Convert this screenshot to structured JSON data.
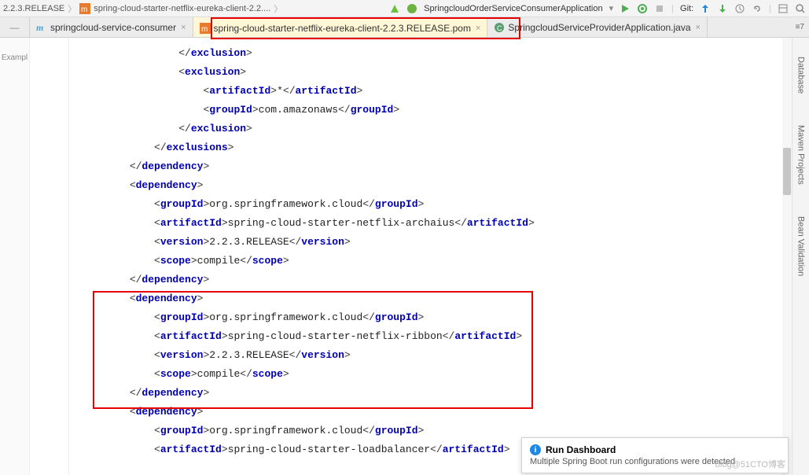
{
  "breadcrumb": {
    "item1": "2.2.3.RELEASE",
    "item2": "spring-cloud-starter-netflix-eureka-client-2.2...."
  },
  "runConfig": {
    "name": "SpringcloudOrderServiceConsumerApplication"
  },
  "git": {
    "label": "Git:"
  },
  "leftGutter": {
    "label": "Exampl"
  },
  "tabs": {
    "t1": "springcloud-service-consumer",
    "t2": "spring-cloud-starter-netflix-eureka-client-2.2.3.RELEASE.pom",
    "t3": "SpringcloudServiceProviderApplication.java"
  },
  "tabsRight": {
    "indicator": "≡7"
  },
  "code": {
    "l1_a": "</",
    "l1_b": "exclusion",
    "l1_c": ">",
    "l2_a": "<",
    "l2_b": "exclusion",
    "l2_c": ">",
    "l3_a": "<",
    "l3_b": "artifactId",
    "l3_c": ">",
    "l3_d": "*",
    "l3_e": "</",
    "l3_f": "artifactId",
    "l3_g": ">",
    "l4_a": "<",
    "l4_b": "groupId",
    "l4_c": ">",
    "l4_d": "com.amazonaws",
    "l4_e": "</",
    "l4_f": "groupId",
    "l4_g": ">",
    "l5_a": "</",
    "l5_b": "exclusion",
    "l5_c": ">",
    "l6_a": "</",
    "l6_b": "exclusions",
    "l6_c": ">",
    "l7_a": "</",
    "l7_b": "dependency",
    "l7_c": ">",
    "l8_a": "<",
    "l8_b": "dependency",
    "l8_c": ">",
    "l9_a": "<",
    "l9_b": "groupId",
    "l9_c": ">",
    "l9_d": "org.springframework.cloud",
    "l9_e": "</",
    "l9_f": "groupId",
    "l9_g": ">",
    "l10_a": "<",
    "l10_b": "artifactId",
    "l10_c": ">",
    "l10_d": "spring-cloud-starter-netflix-archaius",
    "l10_e": "</",
    "l10_f": "artifactId",
    "l10_g": ">",
    "l11_a": "<",
    "l11_b": "version",
    "l11_c": ">",
    "l11_d": "2.2.3.RELEASE",
    "l11_e": "</",
    "l11_f": "version",
    "l11_g": ">",
    "l12_a": "<",
    "l12_b": "scope",
    "l12_c": ">",
    "l12_d": "compile",
    "l12_e": "</",
    "l12_f": "scope",
    "l12_g": ">",
    "l13_a": "</",
    "l13_b": "dependency",
    "l13_c": ">",
    "l14_a": "<",
    "l14_b": "dependency",
    "l14_c": ">",
    "l15_a": "<",
    "l15_b": "groupId",
    "l15_c": ">",
    "l15_d": "org.springframework.cloud",
    "l15_e": "</",
    "l15_f": "groupId",
    "l15_g": ">",
    "l16_a": "<",
    "l16_b": "artifactId",
    "l16_c": ">",
    "l16_d": "spring-cloud-starter-netflix-ribbon",
    "l16_e": "</",
    "l16_f": "artifactId",
    "l16_g": ">",
    "l17_a": "<",
    "l17_b": "version",
    "l17_c": ">",
    "l17_d": "2.2.3.RELEASE",
    "l17_e": "</",
    "l17_f": "version",
    "l17_g": ">",
    "l18_a": "<",
    "l18_b": "scope",
    "l18_c": ">",
    "l18_d": "compile",
    "l18_e": "</",
    "l18_f": "scope",
    "l18_g": ">",
    "l19_a": "</",
    "l19_b": "dependency",
    "l19_c": ">",
    "l20_a": "<",
    "l20_b": "dependency",
    "l20_c": ">",
    "l21_a": "<",
    "l21_b": "groupId",
    "l21_c": ">",
    "l21_d": "org.springframework.cloud",
    "l21_e": "</",
    "l21_f": "groupId",
    "l21_g": ">",
    "l22_a": "<",
    "l22_b": "artifactId",
    "l22_c": ">",
    "l22_d": "spring-cloud-starter-loadbalancer",
    "l22_e": "</",
    "l22_f": "artifactId",
    "l22_g": ">"
  },
  "rightTools": {
    "database": "Database",
    "maven": "Maven Projects",
    "bean": "Bean Validation"
  },
  "notif": {
    "title": "Run Dashboard",
    "msg": "Multiple Spring Boot run configurations were detected"
  },
  "watermark": "blog@51CTO博客"
}
